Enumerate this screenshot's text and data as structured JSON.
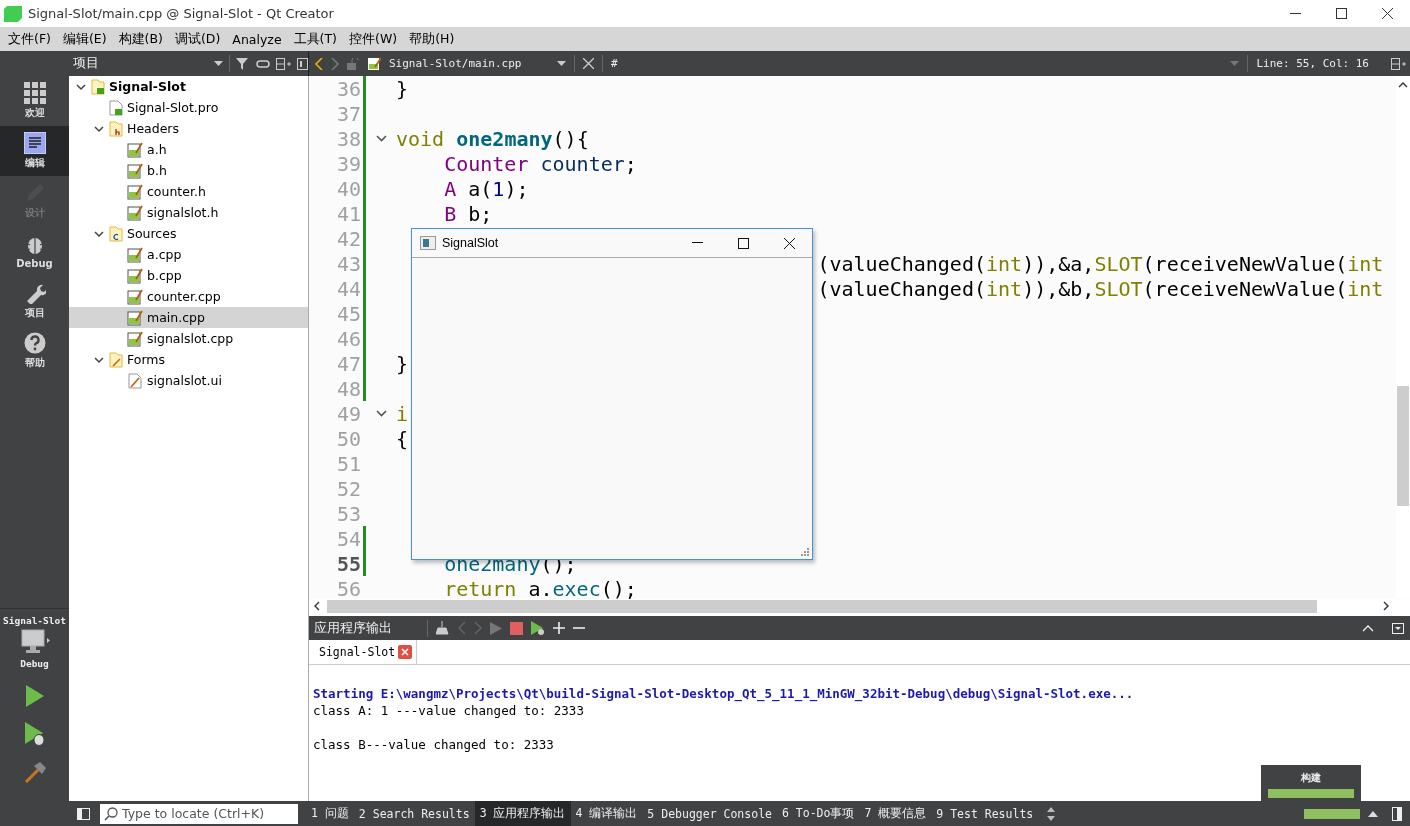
{
  "window": {
    "title": "Signal-Slot/main.cpp @ Signal-Slot - Qt Creator"
  },
  "menu": [
    "文件(F)",
    "编辑(E)",
    "构建(B)",
    "调试(D)",
    "Analyze",
    "工具(T)",
    "控件(W)",
    "帮助(H)"
  ],
  "project_pane": {
    "title": "项目"
  },
  "editor_toolbar": {
    "file": "Signal-Slot/main.cpp",
    "symbol": "#",
    "position": "Line: 55, Col: 16"
  },
  "modes": [
    {
      "label": "欢迎",
      "kind": "welcome",
      "selected": false,
      "disabled": false
    },
    {
      "label": "编辑",
      "kind": "edit",
      "selected": true,
      "disabled": false
    },
    {
      "label": "设计",
      "kind": "design",
      "selected": false,
      "disabled": true
    },
    {
      "label": "Debug",
      "kind": "debug",
      "selected": false,
      "disabled": false
    },
    {
      "label": "项目",
      "kind": "projects",
      "selected": false,
      "disabled": false
    },
    {
      "label": "帮助",
      "kind": "help",
      "selected": false,
      "disabled": false
    }
  ],
  "kit": {
    "project": "Signal-Slot",
    "config": "Debug"
  },
  "tree": [
    {
      "label": "Signal-Slot",
      "kind": "project",
      "expanded": true,
      "selected": false,
      "children": [
        {
          "label": "Signal-Slot.pro",
          "kind": "pro",
          "selected": false
        },
        {
          "label": "Headers",
          "kind": "headers",
          "expanded": true,
          "selected": false,
          "children": [
            {
              "label": "a.h",
              "kind": "file",
              "selected": false
            },
            {
              "label": "b.h",
              "kind": "file",
              "selected": false
            },
            {
              "label": "counter.h",
              "kind": "file",
              "selected": false
            },
            {
              "label": "signalslot.h",
              "kind": "file",
              "selected": false
            }
          ]
        },
        {
          "label": "Sources",
          "kind": "sources",
          "expanded": true,
          "selected": false,
          "children": [
            {
              "label": "a.cpp",
              "kind": "file",
              "selected": false
            },
            {
              "label": "b.cpp",
              "kind": "file",
              "selected": false
            },
            {
              "label": "counter.cpp",
              "kind": "file",
              "selected": false
            },
            {
              "label": "main.cpp",
              "kind": "file",
              "selected": true
            },
            {
              "label": "signalslot.cpp",
              "kind": "file",
              "selected": false
            }
          ]
        },
        {
          "label": "Forms",
          "kind": "forms",
          "expanded": true,
          "selected": false,
          "children": [
            {
              "label": "signalslot.ui",
              "kind": "form",
              "selected": false
            }
          ]
        }
      ]
    }
  ],
  "code": [
    {
      "line": "36",
      "changed": true,
      "fold": false,
      "current": false,
      "kind": "top",
      "tokens": [
        {
          "text": "}",
          "kind": "plain"
        }
      ]
    },
    {
      "line": "37",
      "changed": true,
      "fold": false,
      "current": false
    },
    {
      "line": "38",
      "changed": true,
      "fold": true,
      "current": false,
      "kind": "top",
      "tokens": [
        {
          "text": "void",
          "kind": "keyword"
        },
        {
          "text": " one2many",
          "kind": "function"
        },
        {
          "text": "(){",
          "kind": "plain"
        }
      ]
    },
    {
      "line": "39",
      "changed": true,
      "fold": false,
      "current": false,
      "kind": "body",
      "tokens": [
        {
          "text": "Counter",
          "kind": "type"
        },
        {
          "text": " counter",
          "kind": "variable"
        },
        {
          "text": ";",
          "kind": "plain"
        }
      ]
    },
    {
      "line": "40",
      "changed": true,
      "fold": false,
      "current": false,
      "kind": "body",
      "tokens": [
        {
          "text": "A",
          "kind": "type"
        },
        {
          "text": " a(",
          "kind": "plain"
        },
        {
          "text": "1",
          "kind": "number"
        },
        {
          "text": ");",
          "kind": "plain"
        }
      ]
    },
    {
      "line": "41",
      "changed": true,
      "fold": false,
      "current": false,
      "kind": "body",
      "tokens": [
        {
          "text": "B",
          "kind": "type"
        },
        {
          "text": " b;",
          "kind": "plain"
        }
      ]
    },
    {
      "line": "42",
      "changed": true,
      "fold": false,
      "current": false
    },
    {
      "line": "43",
      "changed": true,
      "fold": false,
      "current": false,
      "kind": "tail",
      "tokens": [
        {
          "text": "(valueChanged(",
          "kind": "plain"
        },
        {
          "text": "int",
          "kind": "keyword"
        },
        {
          "text": ")),&a,",
          "kind": "plain"
        },
        {
          "text": "SLOT",
          "kind": "keyword"
        },
        {
          "text": "(receiveNewValue(",
          "kind": "plain"
        },
        {
          "text": "int",
          "kind": "keyword"
        }
      ]
    },
    {
      "line": "44",
      "changed": true,
      "fold": false,
      "current": false,
      "kind": "tail",
      "tokens": [
        {
          "text": "(valueChanged(",
          "kind": "plain"
        },
        {
          "text": "int",
          "kind": "keyword"
        },
        {
          "text": ")),&b,",
          "kind": "plain"
        },
        {
          "text": "SLOT",
          "kind": "keyword"
        },
        {
          "text": "(receiveNewValue(",
          "kind": "plain"
        },
        {
          "text": "int",
          "kind": "keyword"
        }
      ]
    },
    {
      "line": "45",
      "changed": true,
      "fold": false,
      "current": false
    },
    {
      "line": "46",
      "changed": true,
      "fold": false,
      "current": false
    },
    {
      "line": "47",
      "changed": true,
      "fold": false,
      "current": false,
      "kind": "top",
      "tokens": [
        {
          "text": "}",
          "kind": "plain"
        }
      ]
    },
    {
      "line": "48",
      "changed": true,
      "fold": false,
      "current": false
    },
    {
      "line": "49",
      "changed": false,
      "fold": true,
      "current": false,
      "kind": "top",
      "tokens": [
        {
          "text": "i",
          "kind": "keyword"
        }
      ]
    },
    {
      "line": "50",
      "changed": false,
      "fold": false,
      "current": false,
      "kind": "top",
      "tokens": [
        {
          "text": "{",
          "kind": "plain"
        }
      ]
    },
    {
      "line": "51",
      "changed": false,
      "fold": false,
      "current": false
    },
    {
      "line": "52",
      "changed": false,
      "fold": false,
      "current": false
    },
    {
      "line": "53",
      "changed": false,
      "fold": false,
      "current": false
    },
    {
      "line": "54",
      "changed": true,
      "fold": false,
      "current": false
    },
    {
      "line": "55",
      "changed": true,
      "fold": false,
      "current": true,
      "kind": "body",
      "tokens": [
        {
          "text": "one2many",
          "kind": "call"
        },
        {
          "text": "();",
          "kind": "plain"
        }
      ]
    },
    {
      "line": "56",
      "changed": false,
      "fold": false,
      "current": false,
      "kind": "body",
      "tokens": [
        {
          "text": "return",
          "kind": "keyword"
        },
        {
          "text": " a.",
          "kind": "plain"
        },
        {
          "text": "exec",
          "kind": "call"
        },
        {
          "text": "();",
          "kind": "plain"
        }
      ]
    }
  ],
  "app_window": {
    "title": "SignalSlot"
  },
  "output": {
    "title": "应用程序输出",
    "tab": "Signal-Slot",
    "lines": [
      {
        "text": "Starting E:\\wangmz\\Projects\\Qt\\build-Signal-Slot-Desktop_Qt_5_11_1_MinGW_32bit-Debug\\debug\\Signal-Slot.exe...",
        "kind": "info"
      },
      {
        "text": "class A: 1 ---value changed to: 2333",
        "kind": "plain"
      },
      {
        "kind": "blank"
      },
      {
        "text": "class B---value changed to: 2333",
        "kind": "plain"
      }
    ]
  },
  "status_bar": {
    "locate_placeholder": "Type to locate (Ctrl+K)",
    "panes": [
      {
        "label": "1 问题",
        "selected": false
      },
      {
        "label": "2 Search Results",
        "selected": false
      },
      {
        "label": "3 应用程序输出",
        "selected": true
      },
      {
        "label": "4 编译输出",
        "selected": false
      },
      {
        "label": "5 Debugger Console",
        "selected": false
      },
      {
        "label": "6 To-Do事项",
        "selected": false
      },
      {
        "label": "7 概要信息",
        "selected": false
      },
      {
        "label": "9 Test Results",
        "selected": false
      }
    ],
    "build": {
      "label": "构建",
      "level": 1
    }
  }
}
